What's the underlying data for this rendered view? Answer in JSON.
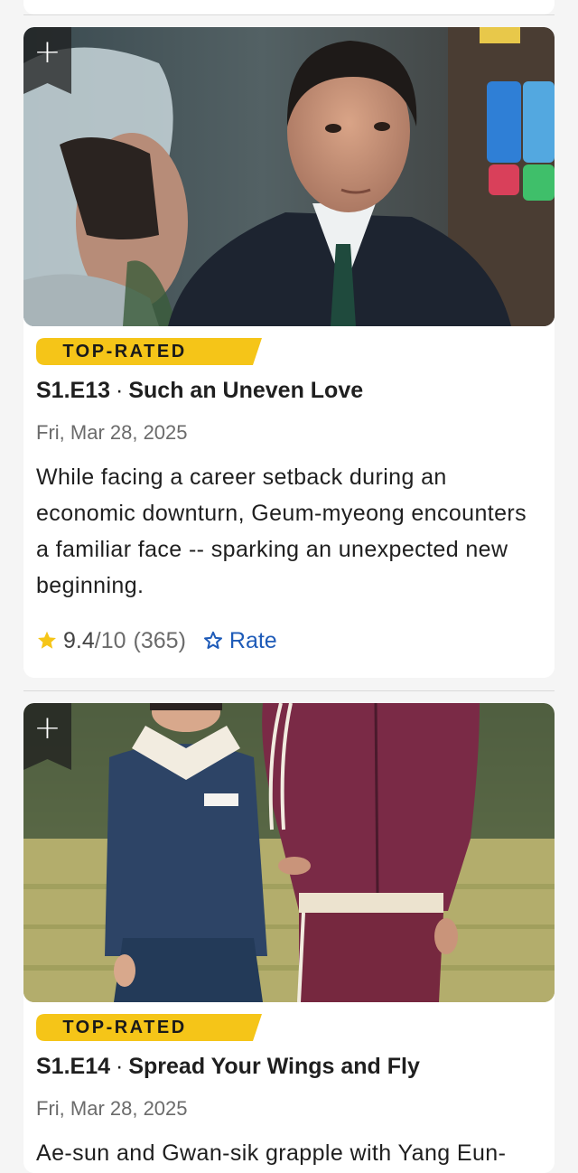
{
  "episodes": [
    {
      "badge": "TOP-RATED",
      "code": "S1.E13",
      "separator": "·",
      "title": "Such an Uneven Love",
      "date": "Fri, Mar 28, 2025",
      "description": "While facing a career setback during an economic downturn, Geum-myeong encounters a familiar face -- sparking an unexpected new beginning.",
      "rating": "9.4",
      "rating_max": "/10",
      "rating_count": "(365)",
      "rate_label": "Rate",
      "watchlist_icon": "+"
    },
    {
      "badge": "TOP-RATED",
      "code": "S1.E14",
      "separator": "·",
      "title": "Spread Your Wings and Fly",
      "date": "Fri, Mar 28, 2025",
      "description": "Ae-sun and Gwan-sik grapple with Yang Eun-",
      "watchlist_icon": "+"
    }
  ],
  "icons": {
    "rating": "star-icon",
    "rate": "star-outline-icon",
    "watchlist": "plus-icon"
  },
  "colors": {
    "badge": "#f5c518",
    "link": "#1e5bb8",
    "ribbon": "#1f1f1f"
  }
}
